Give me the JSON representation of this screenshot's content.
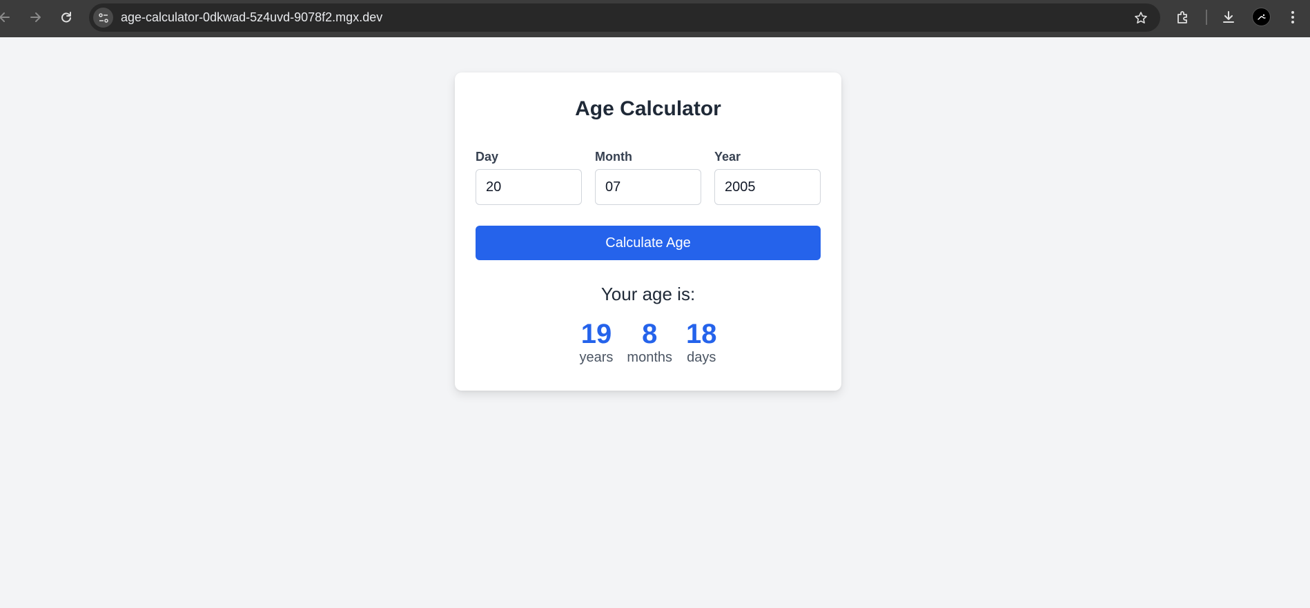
{
  "browser": {
    "url": "age-calculator-0dkwad-5z4uvd-9078f2.mgx.dev",
    "icons": [
      "back-icon",
      "forward-icon",
      "reload-icon",
      "site-info-icon",
      "bookmark-star-icon",
      "extensions-icon",
      "download-icon",
      "profile-avatar",
      "more-menu-icon"
    ]
  },
  "app": {
    "title": "Age Calculator",
    "fields": {
      "day": {
        "label": "Day",
        "value": "20"
      },
      "month": {
        "label": "Month",
        "value": "07"
      },
      "year": {
        "label": "Year",
        "value": "2005"
      }
    },
    "button_label": "Calculate Age",
    "result": {
      "heading": "Your age is:",
      "years": {
        "value": "19",
        "label": "years"
      },
      "months": {
        "value": "8",
        "label": "months"
      },
      "days": {
        "value": "18",
        "label": "days"
      }
    }
  },
  "colors": {
    "accent": "#2563eb",
    "page_background": "#f3f4f6",
    "card_background": "#ffffff"
  }
}
